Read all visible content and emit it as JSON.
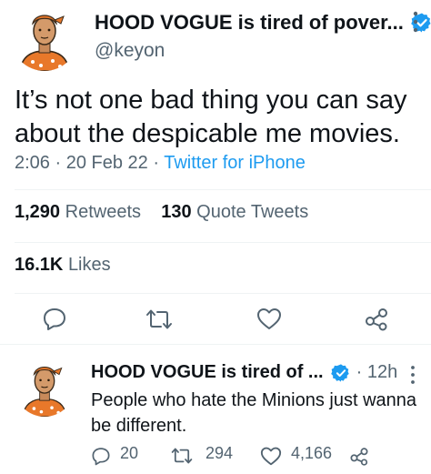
{
  "tweet": {
    "display_name": "HOOD VOGUE is tired of pover...",
    "handle": "@keyon",
    "text": "It’s not one bad thing you can say about the despicable me movies.",
    "time": "2:06",
    "date": "20 Feb 22",
    "separator": "·",
    "source": "Twitter for iPhone",
    "retweets_count": "1,290",
    "retweets_label": "Retweets",
    "quotes_count": "130",
    "quotes_label": "Quote Tweets",
    "likes_count": "16.1K",
    "likes_label": "Likes"
  },
  "reply": {
    "display_name": "HOOD VOGUE is tired of ...",
    "time": "12h",
    "separator": "·",
    "text": "People who hate the Minions just wanna be different.",
    "replies": "20",
    "retweets": "294",
    "likes": "4,166"
  },
  "colors": {
    "accent": "#1d9bf0",
    "text": "#0f1419",
    "muted": "#536471",
    "divider": "#eff3f4",
    "avatar_shirt": "#e8782a"
  },
  "icons": [
    "verified-icon",
    "more-icon",
    "reply-icon",
    "retweet-icon",
    "like-icon",
    "share-icon"
  ]
}
